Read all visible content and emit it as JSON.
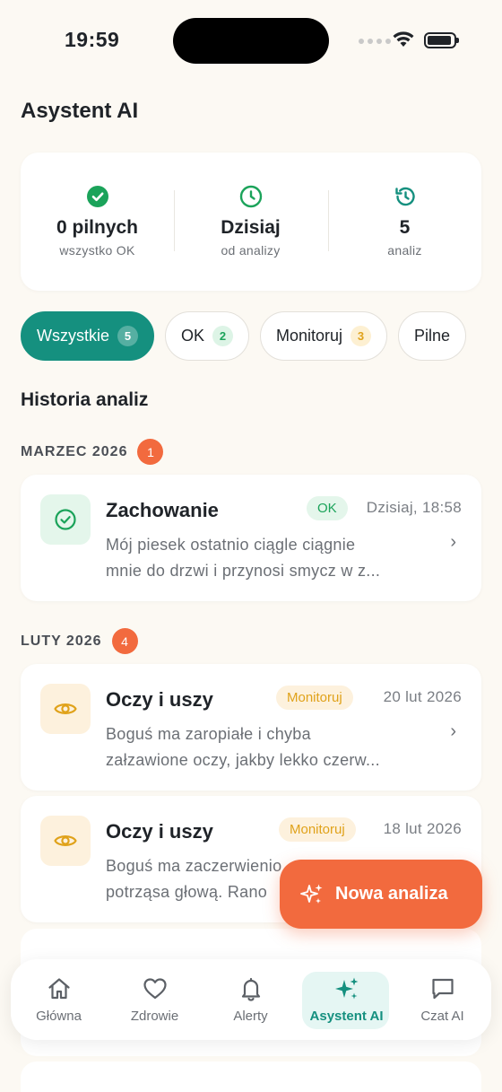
{
  "status_bar": {
    "time": "19:59"
  },
  "header": {
    "title": "Asystent AI"
  },
  "summary": {
    "urgent": {
      "value": "0 pilnych",
      "sub": "wszystko OK",
      "color": "#1BA35A"
    },
    "last": {
      "value": "Dzisiaj",
      "sub": "od analizy",
      "color": "#1BA35A"
    },
    "total": {
      "value": "5",
      "sub": "analiz",
      "color": "#15907F"
    }
  },
  "filters": [
    {
      "label": "Wszystkie",
      "count": "5",
      "active": true
    },
    {
      "label": "OK",
      "count": "2"
    },
    {
      "label": "Monitoruj",
      "count": "3"
    },
    {
      "label": "Pilne"
    }
  ],
  "history": {
    "title": "Historia analiz",
    "groups": [
      {
        "month": "MARZEC 2026",
        "count": "1",
        "items": [
          {
            "icon": "check-circle-icon",
            "title": "Zachowanie",
            "tag": "OK",
            "date": "Dzisiaj, 18:58",
            "desc_line1": "Mój piesek ostatnio ciągle ciągnie",
            "desc_line2": "mnie do drzwi i przynosi smycz w z..."
          }
        ]
      },
      {
        "month": "LUTY 2026",
        "count": "4",
        "items": [
          {
            "icon": "eye-icon",
            "title": "Oczy i uszy",
            "tag": "Monitoruj",
            "date": "20 lut 2026",
            "desc_line1": "Boguś ma zaropiałe i chyba",
            "desc_line2": "załzawione oczy, jakby lekko czerw..."
          },
          {
            "icon": "eye-icon",
            "title": "Oczy i uszy",
            "tag": "Monitoruj",
            "date": "18 lut 2026",
            "desc_line1": "Boguś ma zaczerwienio",
            "desc_line2": "potrząsa głową. Rano"
          }
        ]
      }
    ]
  },
  "fab": {
    "label": "Nowa analiza"
  },
  "tabbar": [
    {
      "label": "Główna",
      "icon": "home-icon"
    },
    {
      "label": "Zdrowie",
      "icon": "heart-icon"
    },
    {
      "label": "Alerty",
      "icon": "bell-icon"
    },
    {
      "label": "Asystent AI",
      "icon": "sparkles-icon",
      "active": true
    },
    {
      "label": "Czat AI",
      "icon": "chat-icon"
    }
  ],
  "colors": {
    "teal": "#15907F",
    "orange": "#F26A3E",
    "ok_green": "#1BA35A",
    "warn_amber": "#E0A21A",
    "background": "#FCF9F3"
  }
}
